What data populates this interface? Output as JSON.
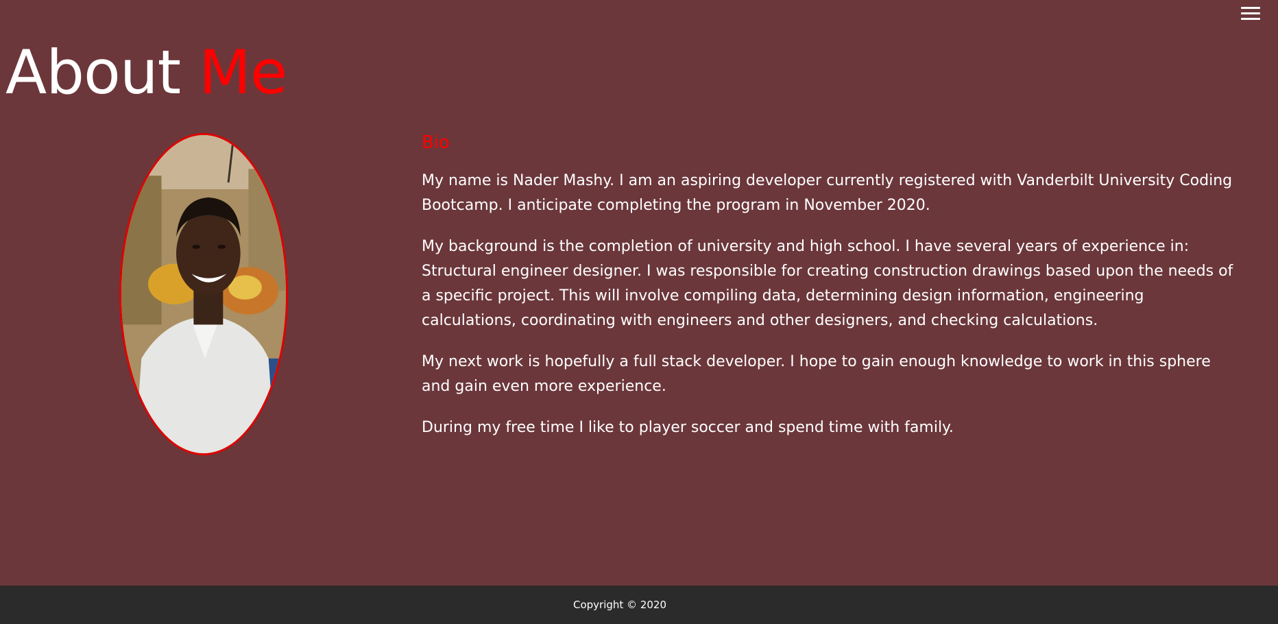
{
  "header": {
    "menu_icon": "hamburger-menu-icon"
  },
  "title": {
    "part1": "About ",
    "part2": "Me"
  },
  "profile": {
    "photo_alt": "Profile photo"
  },
  "bio": {
    "heading": "Bio",
    "paragraphs": [
      "My name is Nader Mashy. I am an aspiring developer currently registered with Vanderbilt University Coding Bootcamp. I anticipate completing the program in November 2020.",
      "My background is the completion of university and high school. I have several years of experience in: Structural engineer designer. I was responsible for creating construction drawings based upon the needs of a specific project. This will involve compiling data, determining design information, engineering calculations, coordinating with engineers and other designers, and checking calculations.",
      "My next work is hopefully a full stack developer. I hope to gain enough knowledge to work in this sphere and gain even more experience.",
      "During my free time I like to player soccer and spend time with family."
    ]
  },
  "footer": {
    "copyright": "Copyright © 2020"
  },
  "colors": {
    "background": "#6b373b",
    "accent": "#ff0000",
    "footer": "#2b2b2b",
    "text": "#ffffff"
  }
}
